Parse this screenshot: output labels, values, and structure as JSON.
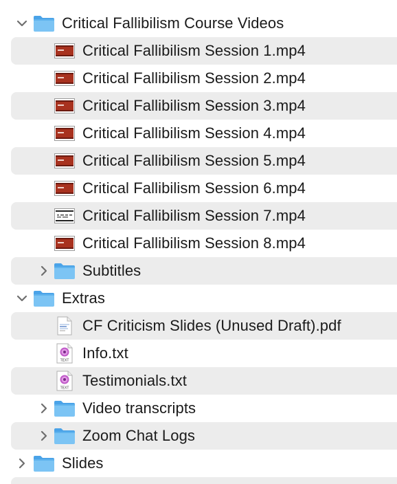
{
  "tree": {
    "course_folder": {
      "label": "Critical Fallibilism Course Videos",
      "icon": "folder-icon",
      "expanded": true
    },
    "sessions": [
      {
        "label": "Critical Fallibilism Session 1.mp4",
        "icon": "video-thumbnail-icon"
      },
      {
        "label": "Critical Fallibilism Session 2.mp4",
        "icon": "video-thumbnail-icon"
      },
      {
        "label": "Critical Fallibilism Session 3.mp4",
        "icon": "video-thumbnail-icon"
      },
      {
        "label": "Critical Fallibilism Session 4.mp4",
        "icon": "video-thumbnail-icon"
      },
      {
        "label": "Critical Fallibilism Session 5.mp4",
        "icon": "video-thumbnail-icon"
      },
      {
        "label": "Critical Fallibilism Session 6.mp4",
        "icon": "video-thumbnail-icon"
      },
      {
        "label": "Critical Fallibilism Session 7.mp4",
        "icon": "video-thumbnail-white-icon"
      },
      {
        "label": "Critical Fallibilism Session 8.mp4",
        "icon": "video-thumbnail-icon"
      }
    ],
    "subtitles_folder": {
      "label": "Subtitles",
      "icon": "folder-icon",
      "expanded": false
    },
    "extras_folder": {
      "label": "Extras",
      "icon": "folder-icon",
      "expanded": true
    },
    "extras_items": [
      {
        "label": "CF Criticism Slides (Unused Draft).pdf",
        "icon": "pdf-document-icon",
        "kind": "file"
      },
      {
        "label": "Info.txt",
        "icon": "text-document-icon",
        "kind": "file"
      },
      {
        "label": "Testimonials.txt",
        "icon": "text-document-icon",
        "kind": "file"
      },
      {
        "label": "Video transcripts",
        "icon": "folder-icon",
        "kind": "folder",
        "expanded": false
      },
      {
        "label": "Zoom Chat Logs",
        "icon": "folder-icon",
        "kind": "folder",
        "expanded": false
      }
    ],
    "slides_folder": {
      "label": "Slides",
      "icon": "folder-icon",
      "expanded": false
    },
    "text_icon_caption": "TEXT"
  },
  "colors": {
    "stripe": "#ececec",
    "folder_light": "#7cc4f4",
    "folder_dark": "#4aa3e8",
    "video_red": "#a8321f",
    "chevron": "#6e6e6e"
  }
}
